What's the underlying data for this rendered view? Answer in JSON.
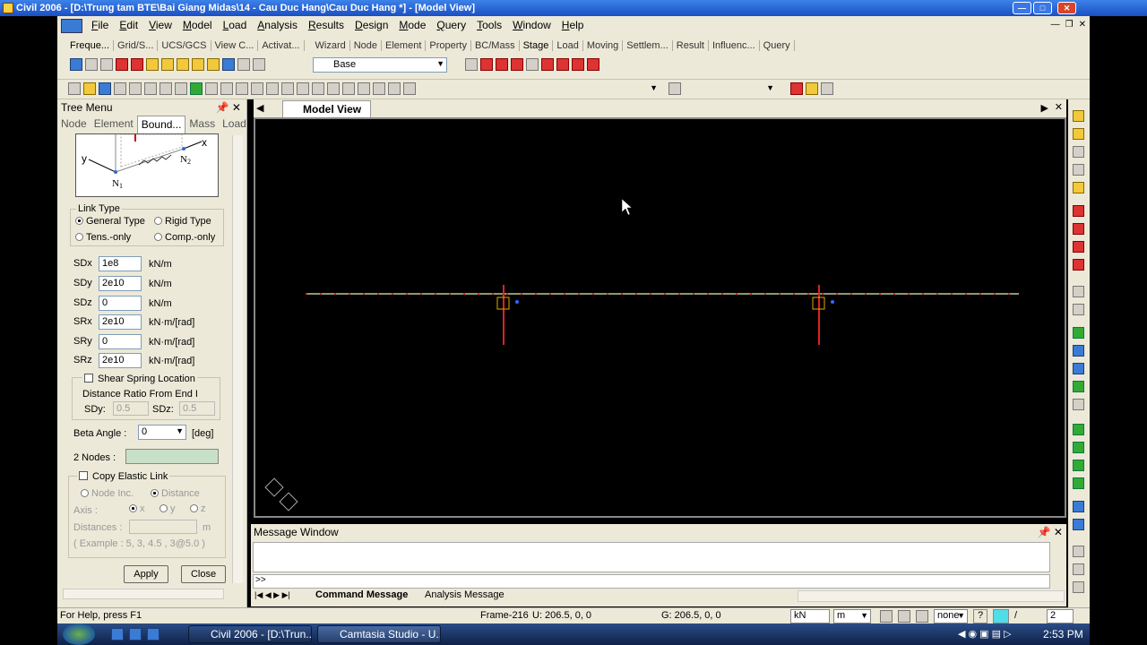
{
  "window": {
    "title": "Civil 2006 - [D:\\Trung tam BTE\\Bai Giang Midas\\14 - Cau Duc Hang\\Cau Duc Hang *] - [Model View]"
  },
  "menu": [
    "File",
    "Edit",
    "View",
    "Model",
    "Load",
    "Analysis",
    "Results",
    "Design",
    "Mode",
    "Query",
    "Tools",
    "Window",
    "Help"
  ],
  "toolbar_tabs": [
    "Freque...",
    "Grid/S...",
    "UCS/GCS",
    "View C...",
    "Activat...",
    "Wizard",
    "Node",
    "Element",
    "Property",
    "BC/Mass",
    "Stage",
    "Load",
    "Moving",
    "Settlem...",
    "Result",
    "Influenc...",
    "Query"
  ],
  "stage_combo": "Base",
  "tree": {
    "title": "Tree Menu",
    "tabs": [
      "Node",
      "Element",
      "Bound...",
      "Mass",
      "Load"
    ],
    "diagram": {
      "y": "y",
      "x": "x",
      "n1": "N",
      "n1_sub": "1",
      "n2": "N",
      "n2_sub": "2"
    },
    "link_type": {
      "legend": "Link Type",
      "general": "General Type",
      "rigid": "Rigid Type",
      "tens": "Tens.-only",
      "comp": "Comp.-only"
    },
    "fields": [
      {
        "label": "SDx",
        "value": "1e8",
        "unit": "kN/m"
      },
      {
        "label": "SDy",
        "value": "2e10",
        "unit": "kN/m"
      },
      {
        "label": "SDz",
        "value": "0",
        "unit": "kN/m"
      },
      {
        "label": "SRx",
        "value": "2e10",
        "unit": "kN·m/[rad]"
      },
      {
        "label": "SRy",
        "value": "0",
        "unit": "kN·m/[rad]"
      },
      {
        "label": "SRz",
        "value": "2e10",
        "unit": "kN·m/[rad]"
      }
    ],
    "shear": {
      "checkbox": "Shear Spring Location",
      "ratio": "Distance Ratio From End I",
      "sdy_label": "SDy:",
      "sdy": "0.5",
      "sdz_label": "SDz:",
      "sdz": "0.5"
    },
    "beta": {
      "label": "Beta Angle :",
      "value": "0",
      "unit": "[deg]"
    },
    "nodes_label": "2 Nodes :",
    "copy": {
      "checkbox": "Copy Elastic Link",
      "node_inc": "Node Inc.",
      "distance": "Distance",
      "axis_label": "Axis :",
      "ax": "x",
      "ay": "y",
      "az": "z",
      "distances_label": "Distances :",
      "unit": "m",
      "example": "( Example :  5, 3, 4.5 , 3@5.0 )"
    },
    "apply": "Apply",
    "close": "Close"
  },
  "model_view": {
    "tab": "Model View"
  },
  "message_window": {
    "title": "Message Window",
    "prompt": ">>",
    "tabs": [
      "Command Message",
      "Analysis Message"
    ]
  },
  "status": {
    "help": "For Help, press F1",
    "frame": "Frame-216",
    "u": "U: 206.5, 0, 0",
    "g": "G: 206.5, 0, 0",
    "force_unit": "kN",
    "length_unit": "m",
    "none": "none",
    "page": "2",
    "page_total": "/"
  },
  "taskbar": {
    "btn1": "Civil 2006 - [D:\\Trun...",
    "btn2": "Camtasia Studio - U...",
    "time": "2:53 PM"
  }
}
